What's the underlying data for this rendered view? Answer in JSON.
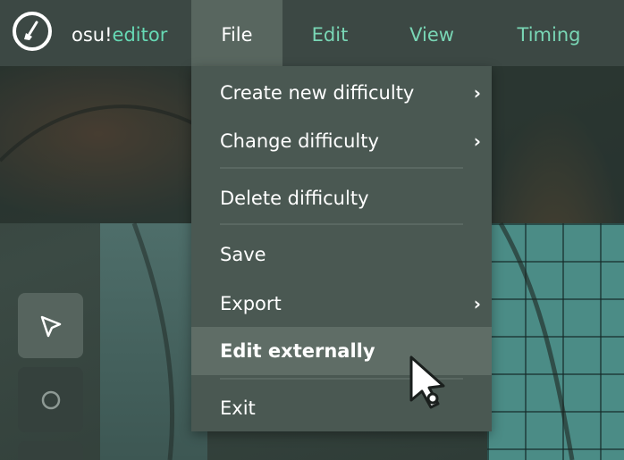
{
  "brand": {
    "part1": "osu!",
    "part2": "editor"
  },
  "menu": {
    "file": "File",
    "edit": "Edit",
    "view": "View",
    "timing": "Timing"
  },
  "file_menu": {
    "create_new_difficulty": "Create new difficulty",
    "change_difficulty": "Change difficulty",
    "delete_difficulty": "Delete difficulty",
    "save": "Save",
    "export": "Export",
    "edit_externally": "Edit externally",
    "exit": "Exit",
    "submenu_chevron": "›"
  },
  "toolbar": {
    "tools": [
      "select-tool",
      "hit-circle-tool"
    ]
  },
  "colors": {
    "accent": "#79d6b5",
    "menubar": "#3c4844",
    "dropdown": "#4a5852"
  }
}
